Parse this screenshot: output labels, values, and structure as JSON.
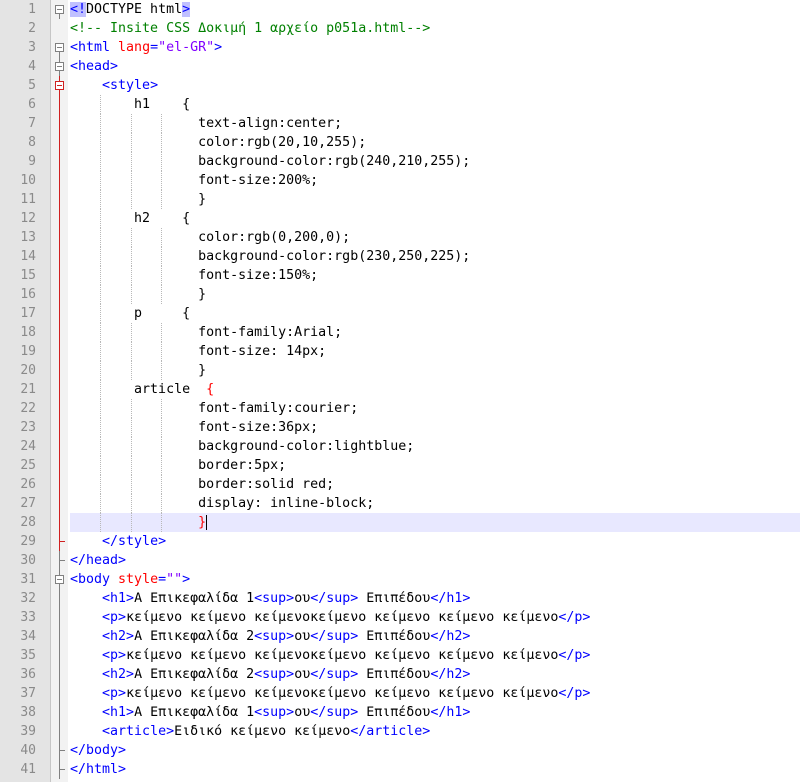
{
  "editor": {
    "lines": [
      {
        "n": "1",
        "fold": "box-top",
        "tokens": [
          {
            "t": "<!",
            "c": "t-tag t-hl"
          },
          {
            "t": "DOCTYPE html",
            "c": "t-txt"
          },
          {
            "t": ">",
            "c": "t-tag t-hl"
          }
        ]
      },
      {
        "n": "2",
        "fold": "none",
        "tokens": [
          {
            "t": "<!-- Insite CSS Δοκιμή 1 αρχείο p051a.html-->",
            "c": "t-cmt"
          }
        ]
      },
      {
        "n": "3",
        "fold": "box-top",
        "tokens": [
          {
            "t": "<html ",
            "c": "t-tag"
          },
          {
            "t": "lang",
            "c": "t-attr"
          },
          {
            "t": "=",
            "c": "t-tag"
          },
          {
            "t": "\"el-GR\"",
            "c": "t-val"
          },
          {
            "t": ">",
            "c": "t-tag"
          }
        ]
      },
      {
        "n": "4",
        "fold": "box",
        "tokens": [
          {
            "t": "<head>",
            "c": "t-tag"
          }
        ]
      },
      {
        "n": "5",
        "fold": "box-red",
        "tokens": [
          {
            "t": "    ",
            "c": "t-txt"
          },
          {
            "t": "<style>",
            "c": "t-tag"
          }
        ]
      },
      {
        "n": "6",
        "fold": "red-line",
        "tokens": [
          {
            "t": "        h1    {",
            "c": "t-txt"
          }
        ]
      },
      {
        "n": "7",
        "fold": "red-line",
        "tokens": [
          {
            "t": "                text-align:center;",
            "c": "t-txt"
          }
        ]
      },
      {
        "n": "8",
        "fold": "red-line",
        "tokens": [
          {
            "t": "                color:rgb(20,10,255);",
            "c": "t-txt"
          }
        ]
      },
      {
        "n": "9",
        "fold": "red-line",
        "tokens": [
          {
            "t": "                background-color:rgb(240,210,255);",
            "c": "t-txt"
          }
        ]
      },
      {
        "n": "10",
        "fold": "red-line",
        "tokens": [
          {
            "t": "                font-size:200%;",
            "c": "t-txt"
          }
        ]
      },
      {
        "n": "11",
        "fold": "red-line",
        "tokens": [
          {
            "t": "                }",
            "c": "t-txt"
          }
        ]
      },
      {
        "n": "12",
        "fold": "red-line",
        "tokens": [
          {
            "t": "        h2    {",
            "c": "t-txt"
          }
        ]
      },
      {
        "n": "13",
        "fold": "red-line",
        "tokens": [
          {
            "t": "                color:rgb(0,200,0);",
            "c": "t-txt"
          }
        ]
      },
      {
        "n": "14",
        "fold": "red-line",
        "tokens": [
          {
            "t": "                background-color:rgb(230,250,225);",
            "c": "t-txt"
          }
        ]
      },
      {
        "n": "15",
        "fold": "red-line",
        "tokens": [
          {
            "t": "                font-size:150%;",
            "c": "t-txt"
          }
        ]
      },
      {
        "n": "16",
        "fold": "red-line",
        "tokens": [
          {
            "t": "                }",
            "c": "t-txt"
          }
        ]
      },
      {
        "n": "17",
        "fold": "red-line",
        "tokens": [
          {
            "t": "        p     {",
            "c": "t-txt"
          }
        ]
      },
      {
        "n": "18",
        "fold": "red-line",
        "tokens": [
          {
            "t": "                font-family:Arial;",
            "c": "t-txt"
          }
        ]
      },
      {
        "n": "19",
        "fold": "red-line",
        "tokens": [
          {
            "t": "                font-size: 14px;",
            "c": "t-txt"
          }
        ]
      },
      {
        "n": "20",
        "fold": "red-line",
        "tokens": [
          {
            "t": "                }",
            "c": "t-txt"
          }
        ]
      },
      {
        "n": "21",
        "fold": "red-line",
        "tokens": [
          {
            "t": "        article  ",
            "c": "t-txt"
          },
          {
            "t": "{",
            "c": "t-red"
          }
        ]
      },
      {
        "n": "22",
        "fold": "red-line",
        "tokens": [
          {
            "t": "                font-family:courier;",
            "c": "t-txt"
          }
        ]
      },
      {
        "n": "23",
        "fold": "red-line",
        "tokens": [
          {
            "t": "                font-size:36px;",
            "c": "t-txt"
          }
        ]
      },
      {
        "n": "24",
        "fold": "red-line",
        "tokens": [
          {
            "t": "                background-color:lightblue;",
            "c": "t-txt"
          }
        ]
      },
      {
        "n": "25",
        "fold": "red-line",
        "tokens": [
          {
            "t": "                border:5px;",
            "c": "t-txt"
          }
        ]
      },
      {
        "n": "26",
        "fold": "red-line",
        "tokens": [
          {
            "t": "                border:solid red;",
            "c": "t-txt"
          }
        ]
      },
      {
        "n": "27",
        "fold": "red-line",
        "tokens": [
          {
            "t": "                display: inline-block;",
            "c": "t-txt"
          }
        ]
      },
      {
        "n": "28",
        "fold": "red-line",
        "current": true,
        "tokens": [
          {
            "t": "                ",
            "c": "t-txt"
          },
          {
            "t": "}",
            "c": "t-red"
          }
        ]
      },
      {
        "n": "29",
        "fold": "red-end",
        "tokens": [
          {
            "t": "    ",
            "c": "t-txt"
          },
          {
            "t": "</style>",
            "c": "t-tag"
          }
        ]
      },
      {
        "n": "30",
        "fold": "end",
        "tokens": [
          {
            "t": "</head>",
            "c": "t-tag"
          }
        ]
      },
      {
        "n": "31",
        "fold": "box",
        "tokens": [
          {
            "t": "<body ",
            "c": "t-tag"
          },
          {
            "t": "style",
            "c": "t-attr"
          },
          {
            "t": "=",
            "c": "t-tag"
          },
          {
            "t": "\"\"",
            "c": "t-val"
          },
          {
            "t": ">",
            "c": "t-tag"
          }
        ]
      },
      {
        "n": "32",
        "fold": "line",
        "tokens": [
          {
            "t": "    ",
            "c": "t-txt"
          },
          {
            "t": "<h1>",
            "c": "t-tag"
          },
          {
            "t": "Α Επικεφαλίδα 1",
            "c": "t-txt"
          },
          {
            "t": "<sup>",
            "c": "t-tag"
          },
          {
            "t": "ου",
            "c": "t-txt"
          },
          {
            "t": "</sup>",
            "c": "t-tag"
          },
          {
            "t": " Επιπέδου",
            "c": "t-txt"
          },
          {
            "t": "</h1>",
            "c": "t-tag"
          }
        ]
      },
      {
        "n": "33",
        "fold": "line",
        "tokens": [
          {
            "t": "    ",
            "c": "t-txt"
          },
          {
            "t": "<p>",
            "c": "t-tag"
          },
          {
            "t": "κείμενο κείμενο κείμενοκείμενο κείμενο κείμενο κείμενο",
            "c": "t-txt"
          },
          {
            "t": "</p>",
            "c": "t-tag"
          }
        ]
      },
      {
        "n": "34",
        "fold": "line",
        "tokens": [
          {
            "t": "    ",
            "c": "t-txt"
          },
          {
            "t": "<h2>",
            "c": "t-tag"
          },
          {
            "t": "Α Επικεφαλίδα 2",
            "c": "t-txt"
          },
          {
            "t": "<sup>",
            "c": "t-tag"
          },
          {
            "t": "ου",
            "c": "t-txt"
          },
          {
            "t": "</sup>",
            "c": "t-tag"
          },
          {
            "t": " Επιπέδου",
            "c": "t-txt"
          },
          {
            "t": "</h2>",
            "c": "t-tag"
          }
        ]
      },
      {
        "n": "35",
        "fold": "line",
        "tokens": [
          {
            "t": "    ",
            "c": "t-txt"
          },
          {
            "t": "<p>",
            "c": "t-tag"
          },
          {
            "t": "κείμενο κείμενο κείμενοκείμενο κείμενο κείμενο κείμενο",
            "c": "t-txt"
          },
          {
            "t": "</p>",
            "c": "t-tag"
          }
        ]
      },
      {
        "n": "36",
        "fold": "line",
        "tokens": [
          {
            "t": "    ",
            "c": "t-txt"
          },
          {
            "t": "<h2>",
            "c": "t-tag"
          },
          {
            "t": "Α Επικεφαλίδα 2",
            "c": "t-txt"
          },
          {
            "t": "<sup>",
            "c": "t-tag"
          },
          {
            "t": "ου",
            "c": "t-txt"
          },
          {
            "t": "</sup>",
            "c": "t-tag"
          },
          {
            "t": " Επιπέδου",
            "c": "t-txt"
          },
          {
            "t": "</h2>",
            "c": "t-tag"
          }
        ]
      },
      {
        "n": "37",
        "fold": "line",
        "tokens": [
          {
            "t": "    ",
            "c": "t-txt"
          },
          {
            "t": "<p>",
            "c": "t-tag"
          },
          {
            "t": "κείμενο κείμενο κείμενοκείμενο κείμενο κείμενο κείμενο",
            "c": "t-txt"
          },
          {
            "t": "</p>",
            "c": "t-tag"
          }
        ]
      },
      {
        "n": "38",
        "fold": "line",
        "tokens": [
          {
            "t": "    ",
            "c": "t-txt"
          },
          {
            "t": "<h1>",
            "c": "t-tag"
          },
          {
            "t": "Α Επικεφαλίδα 1",
            "c": "t-txt"
          },
          {
            "t": "<sup>",
            "c": "t-tag"
          },
          {
            "t": "ου",
            "c": "t-txt"
          },
          {
            "t": "</sup>",
            "c": "t-tag"
          },
          {
            "t": " Επιπέδου",
            "c": "t-txt"
          },
          {
            "t": "</h1>",
            "c": "t-tag"
          }
        ]
      },
      {
        "n": "39",
        "fold": "line",
        "tokens": [
          {
            "t": "    ",
            "c": "t-txt"
          },
          {
            "t": "<article>",
            "c": "t-tag"
          },
          {
            "t": "Ειδικό κείμενο κείμενο",
            "c": "t-txt"
          },
          {
            "t": "</article>",
            "c": "t-tag"
          }
        ]
      },
      {
        "n": "40",
        "fold": "end",
        "tokens": [
          {
            "t": "</body>",
            "c": "t-tag"
          }
        ]
      },
      {
        "n": "41",
        "fold": "end",
        "tokens": [
          {
            "t": "</html>",
            "c": "t-tag"
          }
        ]
      }
    ]
  }
}
